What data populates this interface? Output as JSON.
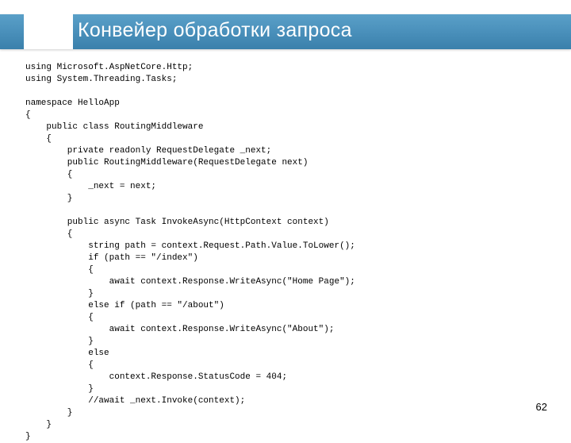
{
  "slide": {
    "title": "Конвейер обработки запроса",
    "page_number": "62",
    "code": "using Microsoft.AspNetCore.Http;\nusing System.Threading.Tasks;\n\nnamespace HelloApp\n{\n    public class RoutingMiddleware\n    {\n        private readonly RequestDelegate _next;\n        public RoutingMiddleware(RequestDelegate next)\n        {\n            _next = next;\n        }\n\n        public async Task InvokeAsync(HttpContext context)\n        {\n            string path = context.Request.Path.Value.ToLower();\n            if (path == \"/index\")\n            {\n                await context.Response.WriteAsync(\"Home Page\");\n            }\n            else if (path == \"/about\")\n            {\n                await context.Response.WriteAsync(\"About\");\n            }\n            else\n            {\n                context.Response.StatusCode = 404;\n            }\n            //await _next.Invoke(context);\n        }\n    }\n}"
  }
}
